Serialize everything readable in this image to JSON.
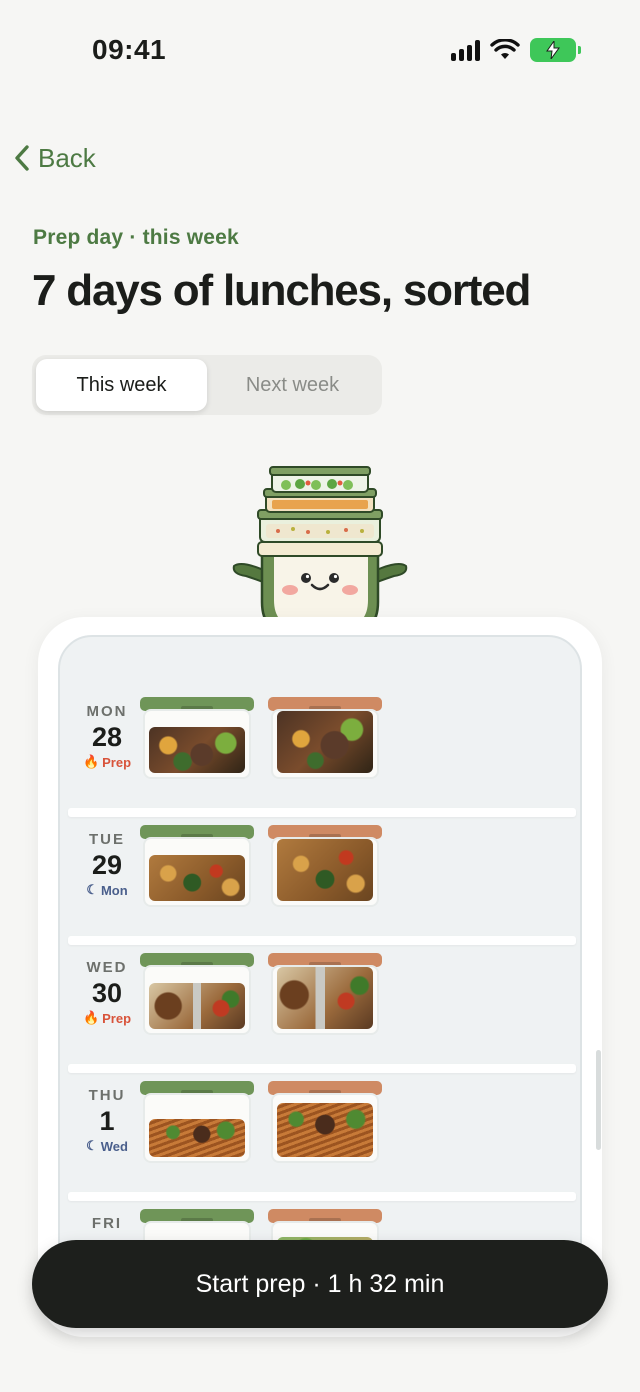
{
  "status_bar": {
    "time": "09:41"
  },
  "nav": {
    "back_label": "Back"
  },
  "header": {
    "eyebrow": "Prep day · this week",
    "title": "7 days of lunches, sorted"
  },
  "segmented": {
    "options": [
      "This week",
      "Next week"
    ],
    "selected": "This week"
  },
  "days": [
    {
      "dow": "MON",
      "num": "28",
      "tag": "Prep",
      "tag_type": "prep",
      "meal": "sweet-potato-bowl"
    },
    {
      "dow": "TUE",
      "num": "29",
      "tag": "Mon",
      "tag_type": "moon",
      "meal": "chickpea-curry"
    },
    {
      "dow": "WED",
      "num": "30",
      "tag": "Prep",
      "tag_type": "prep",
      "meal": "chicken-fajita"
    },
    {
      "dow": "THU",
      "num": "1",
      "tag": "Wed",
      "tag_type": "moon",
      "meal": "beef-noodles"
    },
    {
      "dow": "FRI",
      "num": "",
      "tag": "",
      "tag_type": "",
      "meal": "salad"
    }
  ],
  "cta": {
    "label": "Start prep · 1 h 32 min"
  },
  "colors": {
    "accent_green": "#4d7a43",
    "lid_green": "#6f9558",
    "lid_orange": "#cf8a63",
    "prep_red": "#d8533a",
    "moon_blue": "#4a5f8c",
    "cta_dark": "#1d1f1c"
  }
}
